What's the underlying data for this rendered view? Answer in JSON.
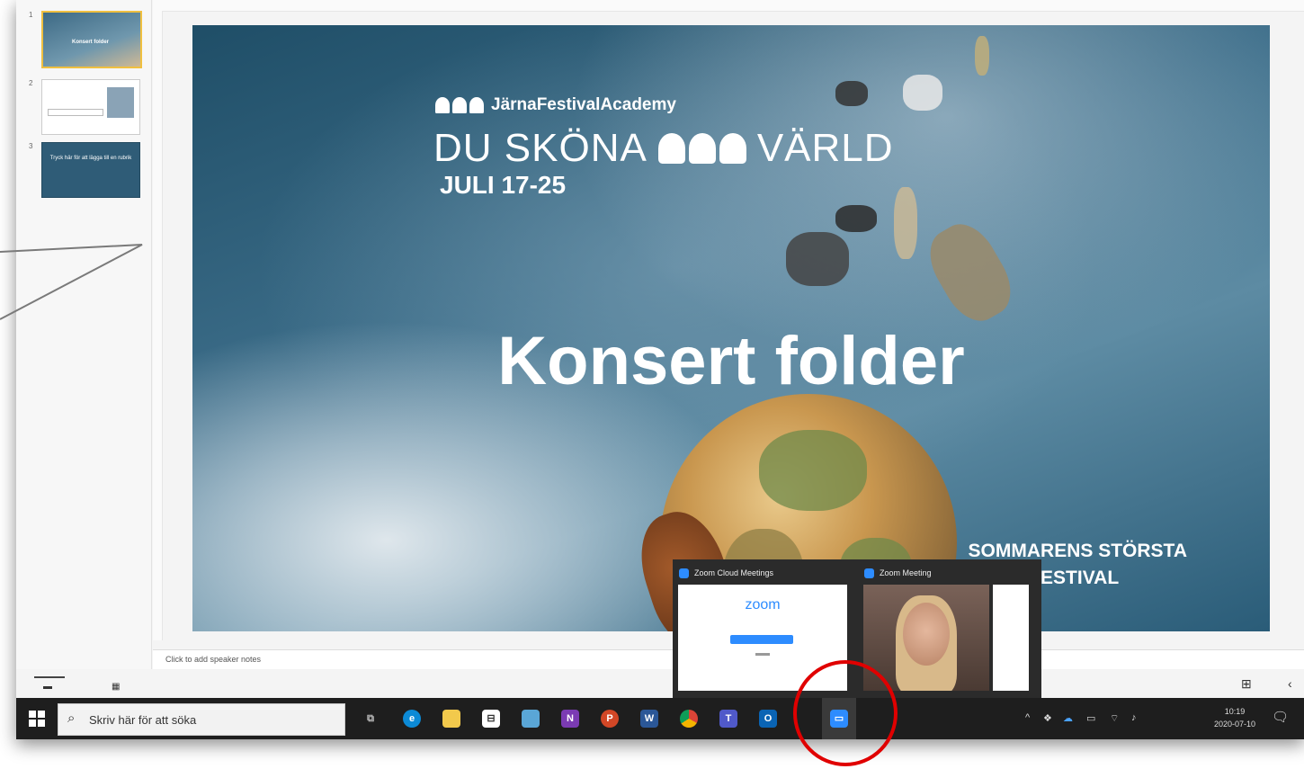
{
  "thumbnails": [
    {
      "number": "1",
      "title": "Konsert folder"
    },
    {
      "number": "2",
      "text": ""
    },
    {
      "number": "3",
      "text": "Tryck här för att lägga till en rubrik"
    }
  ],
  "slide": {
    "brand": "JärnaFestivalAcademy",
    "theme_left": "DU SKÖNA",
    "theme_right": "VÄRLD",
    "dates": "JULI 17-25",
    "title": "Konsert folder",
    "tagline_line1": "SOMMARENS STÖRSTA",
    "tagline_line2": "MUSIKFESTIVAL"
  },
  "notes": {
    "placeholder": "Click to add speaker notes"
  },
  "taskbar": {
    "search_placeholder": "Skriv här för att söka",
    "icons": [
      "task-view-icon",
      "edge-icon",
      "file-explorer-icon",
      "store-icon",
      "photos-icon",
      "onenote-icon",
      "powerpoint-icon",
      "word-icon",
      "chrome-icon",
      "teams-icon",
      "outlook-icon",
      "zoom-icon"
    ],
    "clock_time": "10:19",
    "clock_date": "2020-07-10"
  },
  "zoom_popup": {
    "window1_title": "Zoom Cloud Meetings",
    "window1_logo": "zoom",
    "window2_title": "Zoom Meeting"
  },
  "colors": {
    "zoom_blue": "#2d8cff",
    "annotation_red": "#e00000",
    "taskbar": "#1e1e1e"
  }
}
